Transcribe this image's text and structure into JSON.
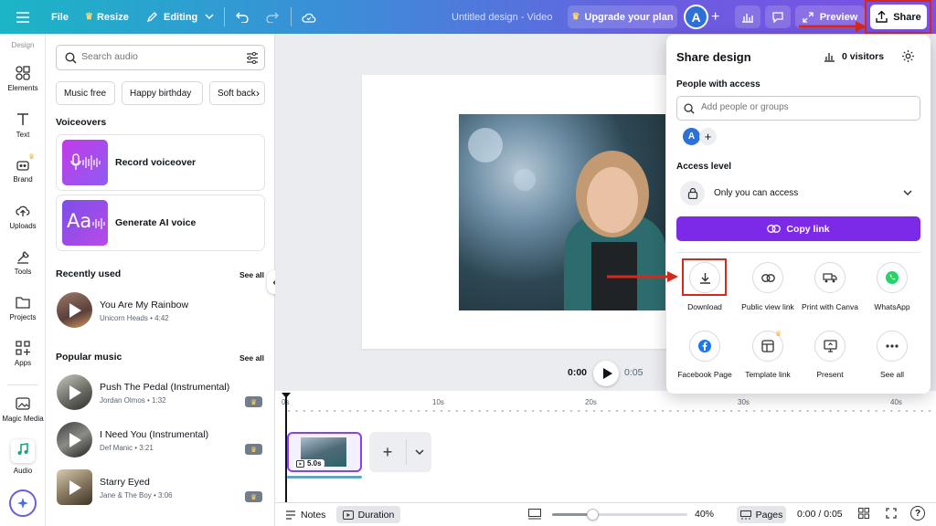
{
  "topbar": {
    "file": "File",
    "resize": "Resize",
    "mode": "Editing",
    "title": "Untitled design - Video",
    "upgrade": "Upgrade your plan",
    "avatar": "A",
    "preview": "Preview",
    "share": "Share"
  },
  "rail": {
    "header": "Design",
    "items": [
      "Elements",
      "Text",
      "Brand",
      "Uploads",
      "Tools",
      "Projects",
      "Apps",
      "Magic Media",
      "Audio"
    ]
  },
  "panel": {
    "search_placeholder": "Search audio",
    "chips": [
      "Music free",
      "Happy birthday",
      "Soft back"
    ],
    "voiceovers_heading": "Voiceovers",
    "voiceovers": [
      "Record voiceover",
      "Generate AI voice"
    ],
    "ai_card_text": "Aa",
    "recent_heading": "Recently used",
    "see_all": "See all",
    "recent": [
      {
        "title": "You Are My Rainbow",
        "sub": "Unicorn Heads • 4:42"
      }
    ],
    "popular_heading": "Popular music",
    "popular": [
      {
        "title": "Push The Pedal (Instrumental)",
        "sub": "Jordan Olmos • 1:32"
      },
      {
        "title": "I Need You (Instrumental)",
        "sub": "Def Manic • 3:21"
      },
      {
        "title": "Starry Eyed",
        "sub": "Jane & The Boy • 3:06"
      }
    ]
  },
  "player": {
    "current": "0:00",
    "duration": "0:05"
  },
  "timeline": {
    "ticks": [
      "0s",
      "10s",
      "20s",
      "30s",
      "40s"
    ],
    "clip_duration": "5.0s"
  },
  "bottombar": {
    "notes": "Notes",
    "duration": "Duration",
    "zoom": "40%",
    "pages": "Pages",
    "time": "0:00 / 0:05",
    "zoom_level": 0.3
  },
  "share": {
    "title": "Share design",
    "visitors": "0 visitors",
    "people_heading": "People with access",
    "add_placeholder": "Add people or groups",
    "avatar": "A",
    "access_heading": "Access level",
    "access_value": "Only you can access",
    "copy_link": "Copy link",
    "options": [
      "Download",
      "Public view link",
      "Print with Canva",
      "WhatsApp",
      "Facebook Page",
      "Template link",
      "Present",
      "See all"
    ]
  },
  "colors": {
    "accent": "#7d2ae8",
    "highlight": "#d42a1c",
    "topbar_start": "#1bb5c6",
    "topbar_end": "#7d4fe4"
  }
}
